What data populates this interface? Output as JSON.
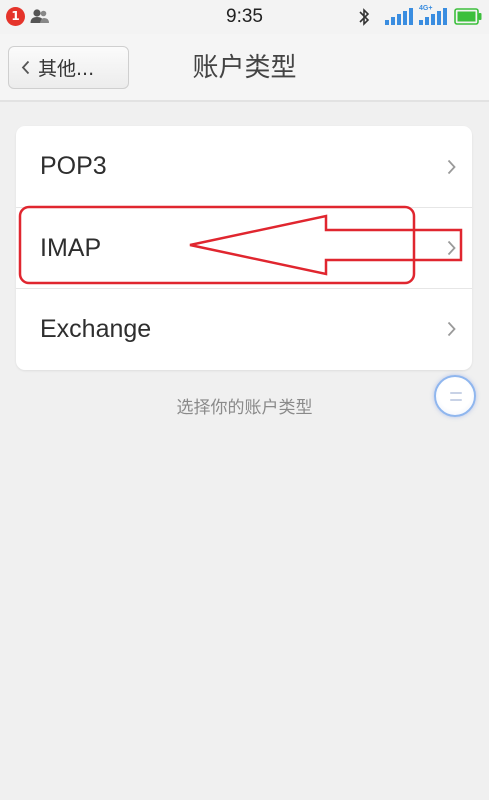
{
  "status_bar": {
    "notification_count": "1",
    "time": "9:35",
    "network_label": "4G+"
  },
  "nav": {
    "back_label": "其他...",
    "title": "账户类型"
  },
  "account_types": [
    {
      "label": "POP3"
    },
    {
      "label": "IMAP"
    },
    {
      "label": "Exchange"
    }
  ],
  "hint": "选择你的账户类型",
  "colors": {
    "annotation": "#e0262f",
    "battery": "#3cbf3c",
    "signal": "#3a8de0",
    "badge": "#e5342b"
  },
  "icons": {
    "back": "chevron-left-icon",
    "row": "chevron-right-icon",
    "bluetooth": "bluetooth-icon",
    "battery": "battery-icon"
  }
}
